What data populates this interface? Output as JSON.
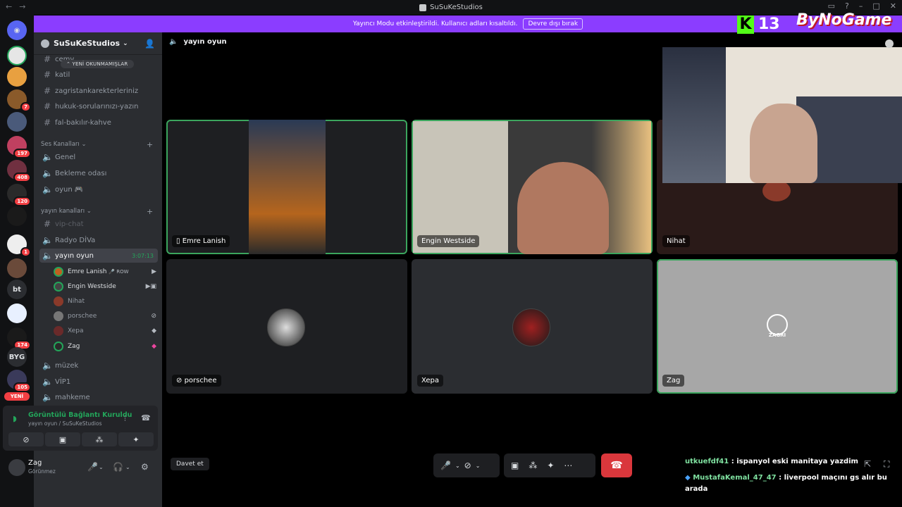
{
  "window": {
    "title": "SuSuKeStudios",
    "back": "←",
    "forward": "→"
  },
  "banner": {
    "text": "Yayıncı Modu etkinleştirildi. Kullanıcı adları kısaltıldı.",
    "button": "Devre dışı bırak"
  },
  "servers": [
    {
      "label": "",
      "badge": ""
    },
    {
      "label": "",
      "badge": "7"
    },
    {
      "label": "",
      "badge": "197"
    },
    {
      "label": "",
      "badge": "408"
    },
    {
      "label": "",
      "badge": "120"
    },
    {
      "label": "",
      "badge": "1"
    },
    {
      "label": "bt",
      "badge": ""
    },
    {
      "label": "",
      "badge": "174"
    },
    {
      "label": "BYG",
      "badge": ""
    },
    {
      "label": "",
      "badge": "105"
    }
  ],
  "servers_new": "YENİ",
  "guild": {
    "name": "SuSuKeStudios"
  },
  "unread_pill": "YENİ OKUNMAMIŞLAR",
  "text_channels": [
    "cemv",
    "katil",
    "zagristankarekterleriniz",
    "hukuk-sorularınızı-yazın",
    "fal-bakılır-kahve"
  ],
  "voice_category": "Ses Kanalları",
  "voice_channels": [
    "Genel",
    "Bekleme odası",
    "oyun 🎮"
  ],
  "stream_category": "yayın kanalları",
  "stream_channels": [
    "vip-chat",
    "Radyo DİVa"
  ],
  "active_channel": {
    "name": "yayın oyun",
    "timer": "3:07:13"
  },
  "members": [
    {
      "name": "Emre Lanish",
      "tag": "🎤 ROW"
    },
    {
      "name": "Engin Westside",
      "tag": ""
    },
    {
      "name": "Nihat",
      "tag": ""
    },
    {
      "name": "porschee",
      "tag": ""
    },
    {
      "name": "Xepa",
      "tag": ""
    },
    {
      "name": "Zag",
      "tag": ""
    }
  ],
  "more_channels": [
    "müzek",
    "VİP1",
    "mahkeme"
  ],
  "voice_panel": {
    "status": "Görüntülü Bağlantı Kuruldu",
    "sub": "yayın oyun / SuSuKeStudios"
  },
  "user_panel": {
    "name": "Zag",
    "status": "Görünmez"
  },
  "header": {
    "title": "yayın oyun"
  },
  "tiles": [
    {
      "name": "Emre Lanish",
      "speaking": true
    },
    {
      "name": "Engin Westside",
      "speaking": true
    },
    {
      "name": "Nihat",
      "speaking": false
    },
    {
      "name": "porschee",
      "speaking": false
    },
    {
      "name": "Xepa",
      "speaking": false
    },
    {
      "name": "Zag",
      "speaking": true
    }
  ],
  "zag_logo": "ZAGRI",
  "invite": "Davet et",
  "overlay": {
    "kick_count": "13",
    "brand": "ByNoGame"
  },
  "chat": [
    {
      "user": "utkuefdf41",
      "text": " : ispanyol eski manitaya yazdim"
    },
    {
      "user": "MustafaKemal_47_47",
      "text": " : liverpool maçını gs alır bu arada"
    }
  ],
  "colors": {
    "accent": "#8b3dff",
    "speaking": "#3ba55d",
    "hangup": "#da373c",
    "kick": "#53fc18"
  }
}
